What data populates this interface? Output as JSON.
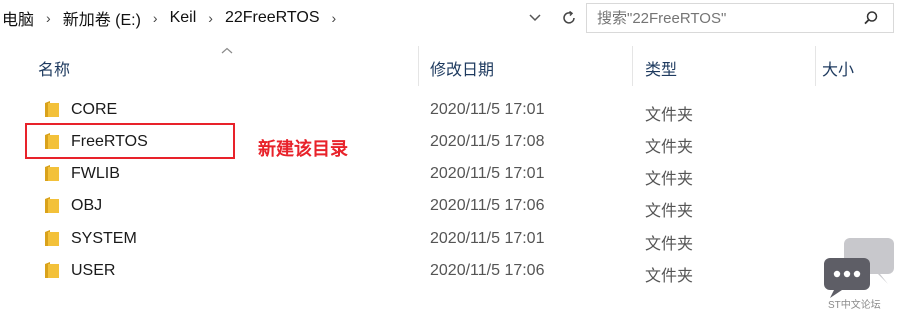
{
  "breadcrumb": {
    "items": [
      "电脑",
      "新加卷 (E:)",
      "Keil",
      "22FreeRTOS"
    ]
  },
  "search": {
    "placeholder": "搜索\"22FreeRTOS\""
  },
  "columns": {
    "name": "名称",
    "date": "修改日期",
    "type": "类型",
    "size": "大小"
  },
  "files": [
    {
      "name": "CORE",
      "date": "2020/11/5 17:01",
      "type": "文件夹"
    },
    {
      "name": "FreeRTOS",
      "date": "2020/11/5 17:08",
      "type": "文件夹"
    },
    {
      "name": "FWLIB",
      "date": "2020/11/5 17:01",
      "type": "文件夹"
    },
    {
      "name": "OBJ",
      "date": "2020/11/5 17:06",
      "type": "文件夹"
    },
    {
      "name": "SYSTEM",
      "date": "2020/11/5 17:01",
      "type": "文件夹"
    },
    {
      "name": "USER",
      "date": "2020/11/5 17:06",
      "type": "文件夹"
    }
  ],
  "annotation": {
    "text": "新建该目录"
  },
  "watermark": {
    "text": "ST中文论坛"
  },
  "colors": {
    "annotation_red": "#e8222a",
    "folder_yellow": "#f3c13a",
    "header_text": "#1e3a5f"
  }
}
